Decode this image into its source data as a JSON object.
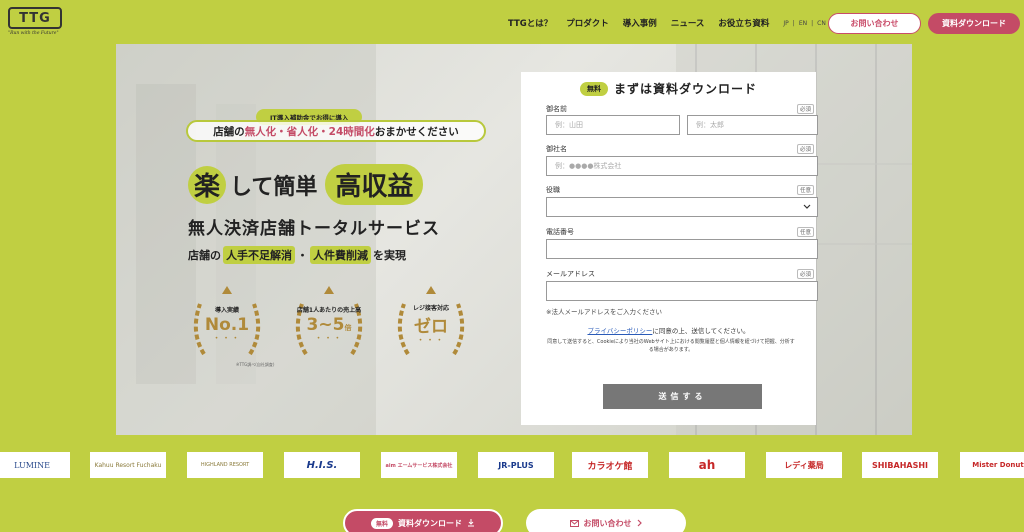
{
  "header": {
    "logo_text": "TTG",
    "logo_tagline": "\"Run with the Future\"",
    "nav": [
      "TTGとは？",
      "プロダクト",
      "導入事例",
      "ニュース",
      "お役立ち資料"
    ],
    "languages": [
      "JP",
      "EN",
      "CN"
    ],
    "contact_label": "お問い合わせ",
    "download_label": "資料ダウンロード"
  },
  "hero": {
    "pill": "IT導入補助金でお得に導入",
    "tagline_prefix": "店舗の",
    "tagline_pink": "無人化・省人化・24時間化",
    "tagline_suffix": "おまかせください",
    "headline_circle": "楽",
    "headline_mid": "して簡単",
    "headline_big": "高収益",
    "subhead": "無人決済店舗トータルサービス",
    "subline_prefix": "店舗の",
    "subline_hl1": "人手不足解消",
    "subline_sep": "・",
    "subline_hl2": "人件費削減",
    "subline_suffix": "を実現",
    "awards": [
      {
        "label": "導入実績",
        "value": "No.1",
        "unit": ""
      },
      {
        "label": "店舗1人あたりの売上高",
        "value": "3~5",
        "unit": "倍"
      },
      {
        "label": "レジ接客対応",
        "value": "ゼロ",
        "unit": ""
      }
    ],
    "award_dots": "• • •",
    "note": "※TTG調べ(自社調査)"
  },
  "form": {
    "badge": "無料",
    "title": "まずは資料ダウンロード",
    "name_label": "御名前",
    "required": "必須",
    "optional": "任意",
    "last_name_placeholder": "例：山田",
    "first_name_placeholder": "例：太郎",
    "company_label": "御社名",
    "company_placeholder": "例：●●●●株式会社",
    "role_label": "役職",
    "phone_label": "電話番号",
    "email_label": "メールアドレス",
    "email_hint": "※法人メールアドレスをご入力ください",
    "privacy_link": "プライバシーポリシー",
    "privacy_suffix": "に同意の上、送信してください。",
    "cookie_text": "同意して送信すると、Cookieにより当社のWebサイト上における閲覧履歴と個人情報を紐づけて把握、分析する場合があります。",
    "submit": "送信する"
  },
  "logos": [
    "LUMINE",
    "Kahuu Resort Fuchaku",
    "HIGHLAND RESORT",
    "H.I.S.",
    "aim エームサービス株式会社",
    "JR-PLUS",
    "カラオケ館",
    "ah",
    "レディ薬局",
    "SHIBAHASHI",
    "Mister Donut"
  ],
  "bottom": {
    "download_badge": "無料",
    "download_label": "資料ダウンロード",
    "contact_label": "お問い合わせ"
  },
  "colors": {
    "background": "#c0cf42",
    "accent_pink": "#c44b66",
    "gold": "#b08a3a",
    "submit_gray": "#777777"
  }
}
